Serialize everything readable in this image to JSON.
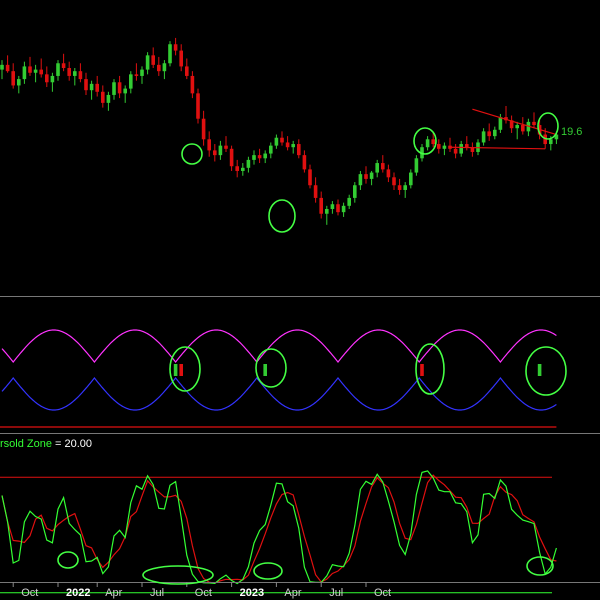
{
  "chart_data": {
    "type": "candlestick",
    "price_panel": {
      "last_price_label": "19.6",
      "colors": {
        "up": "#33cc33",
        "down": "#e01010",
        "trendline": "#e01010",
        "annotation": "#44ff44"
      },
      "candles": [
        [
          0,
          26.0,
          26.6,
          25.4,
          26.3
        ],
        [
          1,
          26.3,
          26.9,
          25.8,
          25.9
        ],
        [
          2,
          25.9,
          26.4,
          24.8,
          25.0
        ],
        [
          3,
          25.0,
          25.6,
          24.5,
          25.4
        ],
        [
          4,
          25.4,
          26.5,
          25.1,
          26.2
        ],
        [
          5,
          26.2,
          26.8,
          25.6,
          25.8
        ],
        [
          6,
          25.8,
          26.3,
          25.2,
          26.0
        ],
        [
          7,
          26.0,
          26.7,
          25.5,
          25.7
        ],
        [
          8,
          25.7,
          26.2,
          24.9,
          25.2
        ],
        [
          9,
          25.2,
          25.8,
          24.6,
          25.6
        ],
        [
          10,
          25.6,
          26.6,
          25.3,
          26.4
        ],
        [
          11,
          26.4,
          27.0,
          25.9,
          26.1
        ],
        [
          12,
          26.1,
          26.5,
          25.3,
          25.6
        ],
        [
          13,
          25.6,
          26.1,
          25.0,
          25.9
        ],
        [
          14,
          25.9,
          26.4,
          25.2,
          25.4
        ],
        [
          15,
          25.4,
          25.8,
          24.4,
          24.7
        ],
        [
          16,
          24.7,
          25.3,
          24.1,
          25.1
        ],
        [
          17,
          25.1,
          25.6,
          24.3,
          24.6
        ],
        [
          18,
          24.6,
          25.0,
          23.6,
          23.9
        ],
        [
          19,
          23.9,
          24.6,
          23.4,
          24.4
        ],
        [
          20,
          24.4,
          25.4,
          24.1,
          25.2
        ],
        [
          21,
          25.2,
          25.6,
          24.2,
          24.5
        ],
        [
          22,
          24.5,
          25.0,
          23.9,
          24.8
        ],
        [
          23,
          24.8,
          25.9,
          24.5,
          25.7
        ],
        [
          24,
          25.7,
          26.4,
          25.3,
          25.6
        ],
        [
          25,
          25.6,
          26.2,
          25.1,
          26.0
        ],
        [
          26,
          26.0,
          27.1,
          25.7,
          26.9
        ],
        [
          27,
          26.9,
          27.4,
          26.1,
          26.3
        ],
        [
          28,
          26.3,
          26.8,
          25.6,
          25.9
        ],
        [
          29,
          25.9,
          26.6,
          25.4,
          26.4
        ],
        [
          30,
          26.4,
          27.8,
          26.2,
          27.6
        ],
        [
          31,
          27.6,
          28.0,
          26.9,
          27.2
        ],
        [
          32,
          27.2,
          27.6,
          25.9,
          26.2
        ],
        [
          33,
          26.2,
          26.7,
          25.4,
          25.6
        ],
        [
          34,
          25.6,
          25.9,
          24.2,
          24.5
        ],
        [
          35,
          24.5,
          24.8,
          22.6,
          22.9
        ],
        [
          36,
          22.9,
          23.4,
          21.2,
          21.6
        ],
        [
          37,
          21.6,
          22.1,
          20.5,
          20.9
        ],
        [
          38,
          20.9,
          21.3,
          20.2,
          20.6
        ],
        [
          39,
          20.6,
          21.5,
          20.3,
          21.2
        ],
        [
          40,
          21.2,
          21.8,
          20.8,
          21.0
        ],
        [
          41,
          21.0,
          21.2,
          19.6,
          19.9
        ],
        [
          42,
          19.9,
          20.3,
          19.2,
          19.6
        ],
        [
          43,
          19.6,
          20.1,
          19.3,
          19.8
        ],
        [
          44,
          19.8,
          20.5,
          19.5,
          20.3
        ],
        [
          45,
          20.3,
          20.9,
          20.0,
          20.6
        ],
        [
          46,
          20.6,
          21.0,
          20.1,
          20.4
        ],
        [
          47,
          20.4,
          20.9,
          20.1,
          20.7
        ],
        [
          48,
          20.7,
          21.4,
          20.4,
          21.2
        ],
        [
          49,
          21.2,
          21.9,
          21.0,
          21.7
        ],
        [
          50,
          21.7,
          22.1,
          21.2,
          21.4
        ],
        [
          51,
          21.4,
          21.8,
          20.9,
          21.1
        ],
        [
          52,
          21.1,
          21.5,
          20.7,
          21.3
        ],
        [
          53,
          21.3,
          21.6,
          20.4,
          20.6
        ],
        [
          54,
          20.6,
          20.9,
          19.5,
          19.7
        ],
        [
          55,
          19.7,
          20.0,
          18.5,
          18.7
        ],
        [
          56,
          18.7,
          19.2,
          17.6,
          17.9
        ],
        [
          57,
          17.9,
          18.3,
          16.6,
          16.9
        ],
        [
          58,
          16.9,
          17.4,
          16.2,
          17.2
        ],
        [
          59,
          17.2,
          17.7,
          16.9,
          17.5
        ],
        [
          60,
          17.5,
          17.8,
          16.8,
          17.0
        ],
        [
          61,
          17.0,
          17.6,
          16.7,
          17.4
        ],
        [
          62,
          17.4,
          18.1,
          17.2,
          17.9
        ],
        [
          63,
          17.9,
          18.9,
          17.6,
          18.7
        ],
        [
          64,
          18.7,
          19.6,
          18.4,
          19.4
        ],
        [
          65,
          19.4,
          19.9,
          18.8,
          19.1
        ],
        [
          66,
          19.1,
          19.6,
          18.7,
          19.5
        ],
        [
          67,
          19.5,
          20.3,
          19.2,
          20.1
        ],
        [
          68,
          20.1,
          20.6,
          19.5,
          19.7
        ],
        [
          69,
          19.7,
          20.0,
          18.9,
          19.2
        ],
        [
          70,
          19.2,
          19.5,
          18.4,
          18.7
        ],
        [
          71,
          18.7,
          19.1,
          18.1,
          18.4
        ],
        [
          72,
          18.4,
          18.9,
          17.9,
          18.7
        ],
        [
          73,
          18.7,
          19.7,
          18.5,
          19.5
        ],
        [
          74,
          19.5,
          20.6,
          19.3,
          20.4
        ],
        [
          75,
          20.4,
          21.3,
          20.2,
          21.1
        ],
        [
          76,
          21.1,
          21.8,
          20.9,
          21.6
        ],
        [
          77,
          21.6,
          22.0,
          21.1,
          21.3
        ],
        [
          78,
          21.3,
          21.6,
          20.7,
          21.0
        ],
        [
          79,
          21.0,
          21.4,
          20.6,
          21.2
        ],
        [
          80,
          21.2,
          21.7,
          20.8,
          21.0
        ],
        [
          81,
          21.0,
          21.3,
          20.4,
          20.7
        ],
        [
          82,
          20.7,
          21.5,
          20.5,
          21.3
        ],
        [
          83,
          21.3,
          21.8,
          20.9,
          21.1
        ],
        [
          84,
          21.1,
          21.4,
          20.5,
          20.8
        ],
        [
          85,
          20.8,
          21.6,
          20.6,
          21.4
        ],
        [
          86,
          21.4,
          22.3,
          21.2,
          22.1
        ],
        [
          87,
          22.1,
          22.6,
          21.5,
          21.8
        ],
        [
          88,
          21.8,
          22.4,
          21.6,
          22.2
        ],
        [
          89,
          22.2,
          23.2,
          22.0,
          23.0
        ],
        [
          90,
          23.0,
          23.7,
          22.6,
          22.8
        ],
        [
          91,
          22.8,
          23.1,
          22.0,
          22.3
        ],
        [
          92,
          22.3,
          22.7,
          21.6,
          22.5
        ],
        [
          93,
          22.5,
          23.0,
          21.9,
          22.1
        ],
        [
          94,
          22.1,
          22.9,
          21.8,
          22.7
        ],
        [
          95,
          22.7,
          23.3,
          22.3,
          22.5
        ],
        [
          96,
          22.5,
          22.8,
          21.6,
          21.9
        ],
        [
          97,
          21.9,
          22.3,
          21.0,
          21.3
        ],
        [
          98,
          21.3,
          21.8,
          20.9,
          21.6
        ],
        [
          99,
          21.6,
          22.1,
          21.3,
          21.9
        ]
      ]
    },
    "band_panel": {
      "colors": {
        "upper": "#ff33ff",
        "lower": "#3333ff",
        "base": "#e01010"
      }
    },
    "oscillator_panel": {
      "zone_label": "rsold Zone",
      "zone_value_text": " = 20.00",
      "upper_level": 80,
      "lower_level": 20,
      "colors": {
        "fast": "#33ff33",
        "slow": "#e01010",
        "zone_line": "#e01010",
        "lower_line": "#33ff33"
      }
    },
    "x_axis": {
      "ticks": [
        {
          "label": "Oct",
          "i": 2
        },
        {
          "label": "2022",
          "i": 10,
          "year": true
        },
        {
          "label": "Apr",
          "i": 17
        },
        {
          "label": "Jul",
          "i": 25
        },
        {
          "label": "Oct",
          "i": 33
        },
        {
          "label": "2023",
          "i": 41,
          "year": true
        },
        {
          "label": "Apr",
          "i": 49
        },
        {
          "label": "Jul",
          "i": 57
        },
        {
          "label": "Oct",
          "i": 65
        }
      ]
    }
  }
}
